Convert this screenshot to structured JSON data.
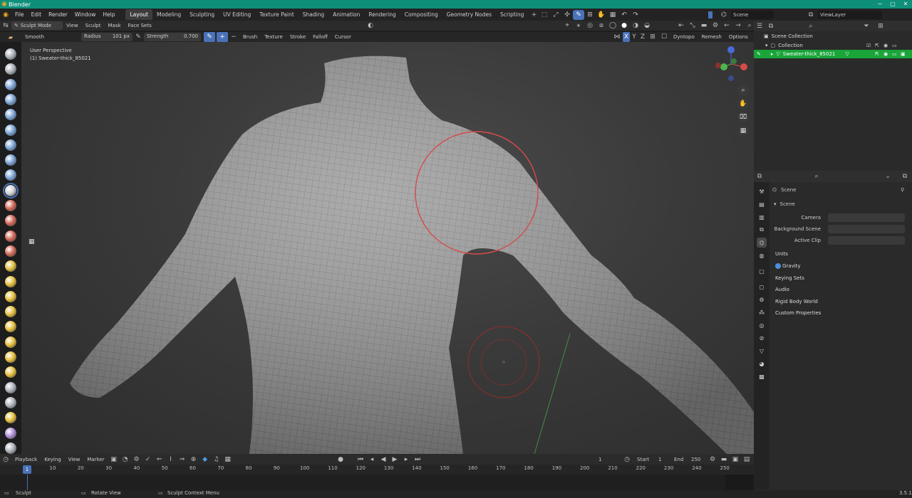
{
  "window": {
    "title": "Blender",
    "version": "3.5.1"
  },
  "menu": [
    "File",
    "Edit",
    "Render",
    "Window",
    "Help"
  ],
  "workspaces": [
    "Layout",
    "Modeling",
    "Sculpting",
    "UV Editing",
    "Texture Paint",
    "Shading",
    "Animation",
    "Rendering",
    "Compositing",
    "Geometry Nodes",
    "Scripting"
  ],
  "active_workspace": "Layout",
  "scene": {
    "name": "Scene",
    "view_layer": "ViewLayer"
  },
  "header": {
    "mode": "Sculpt Mode",
    "menus": [
      "View",
      "Sculpt",
      "Mask",
      "Face Sets"
    ]
  },
  "tool_settings": {
    "brush": "Smooth",
    "radius_label": "Radius",
    "radius_value": "101 px",
    "strength_label": "Strength",
    "strength_value": "0.700",
    "dropdowns": [
      "Brush",
      "Texture",
      "Stroke",
      "Falloff",
      "Cursor"
    ],
    "axes": [
      "X",
      "Y",
      "Z"
    ],
    "right": [
      "Dyntopo",
      "Remesh",
      "Options"
    ]
  },
  "viewport": {
    "view_name": "User Perspective",
    "object_label": "(1) Sweater-thick_85021"
  },
  "outliner": {
    "root": "Scene Collection",
    "collection": "Collection",
    "object": "Sweater-thick_85021"
  },
  "properties": {
    "breadcrumb": "Scene",
    "panel": "Scene",
    "fields": [
      {
        "label": "Camera",
        "value": ""
      },
      {
        "label": "Background Scene",
        "value": ""
      },
      {
        "label": "Active Clip",
        "value": ""
      }
    ],
    "sections": [
      "Units",
      "Gravity",
      "Keying Sets",
      "Audio",
      "Rigid Body World",
      "Custom Properties"
    ]
  },
  "timeline": {
    "menus": [
      "Playback",
      "Keying",
      "View",
      "Marker"
    ],
    "current_frame": "1",
    "start_label": "Start",
    "start": "1",
    "end_label": "End",
    "end": "250",
    "ticks": [
      "10",
      "20",
      "30",
      "40",
      "50",
      "60",
      "70",
      "80",
      "90",
      "100",
      "110",
      "120",
      "130",
      "140",
      "150",
      "160",
      "170",
      "180",
      "190",
      "200",
      "210",
      "220",
      "230",
      "240",
      "250"
    ]
  },
  "status": {
    "left": "Sculpt",
    "middle": "Rotate View",
    "right": "Sculpt Context Menu"
  },
  "colors": {
    "titlebar": "#0e8f7a",
    "selection": "#1aa53a",
    "brush_circle": "#d94a4a",
    "active_tab": "#4a72b8"
  }
}
